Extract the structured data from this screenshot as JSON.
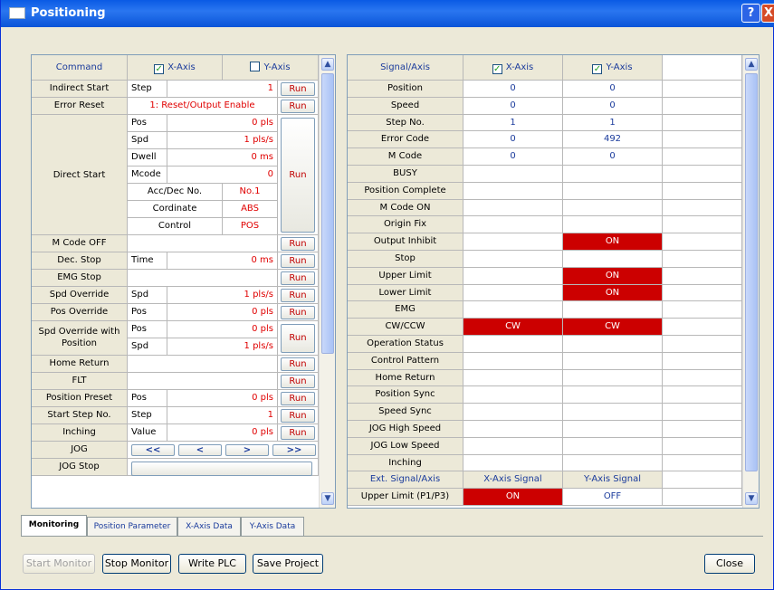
{
  "window": {
    "title": "Positioning",
    "help_icon": "?",
    "close_icon": "X"
  },
  "left": {
    "header": {
      "command": "Command",
      "x_axis": "X-Axis",
      "y_axis": "Y-Axis",
      "x_checked": true,
      "y_checked": false
    },
    "run_label": "Run",
    "rows": {
      "indirect_start": {
        "label": "Indirect Start",
        "sub": "Step",
        "value": "1"
      },
      "error_reset": {
        "label": "Error Reset",
        "value": "1: Reset/Output Enable"
      },
      "direct_start": {
        "label": "Direct Start",
        "pos": {
          "sub": "Pos",
          "value": "0 pls"
        },
        "spd": {
          "sub": "Spd",
          "value": "1 pls/s"
        },
        "dwell": {
          "sub": "Dwell",
          "value": "0 ms"
        },
        "mcode": {
          "sub": "Mcode",
          "value": "0"
        },
        "accdec": {
          "sub": "Acc/Dec No.",
          "value": "No.1"
        },
        "cordinate": {
          "sub": "Cordinate",
          "value": "ABS"
        },
        "control": {
          "sub": "Control",
          "value": "POS"
        }
      },
      "m_code_off": {
        "label": "M Code OFF"
      },
      "dec_stop": {
        "label": "Dec. Stop",
        "sub": "Time",
        "value": "0 ms"
      },
      "emg_stop": {
        "label": "EMG Stop"
      },
      "spd_override": {
        "label": "Spd Override",
        "sub": "Spd",
        "value": "1 pls/s"
      },
      "pos_override": {
        "label": "Pos Override",
        "sub": "Pos",
        "value": "0 pls"
      },
      "spd_override_pos": {
        "label1": "Spd Override with",
        "label2": "Position",
        "sub1": "Pos",
        "value1": "0 pls",
        "sub2": "Spd",
        "value2": "1 pls/s"
      },
      "home_return": {
        "label": "Home Return"
      },
      "flt": {
        "label": "FLT"
      },
      "position_preset": {
        "label": "Position Preset",
        "sub": "Pos",
        "value": "0 pls"
      },
      "start_step": {
        "label": "Start Step No.",
        "sub": "Step",
        "value": "1"
      },
      "inching": {
        "label": "Inching",
        "sub": "Value",
        "value": "0 pls"
      },
      "jog": {
        "label": "JOG",
        "btns": [
          "<<",
          "<",
          ">",
          ">>"
        ]
      },
      "jog_stop": {
        "label": "JOG Stop"
      }
    }
  },
  "right": {
    "header": {
      "signal": "Signal/Axis",
      "x_axis": "X-Axis",
      "y_axis": "Y-Axis",
      "x_checked": true,
      "y_checked": true
    },
    "rows": [
      {
        "label": "Position",
        "x": "0",
        "y": "0",
        "xon": false,
        "yon": false
      },
      {
        "label": "Speed",
        "x": "0",
        "y": "0",
        "xon": false,
        "yon": false
      },
      {
        "label": "Step No.",
        "x": "1",
        "y": "1",
        "xon": false,
        "yon": false
      },
      {
        "label": "Error Code",
        "x": "0",
        "y": "492",
        "xon": false,
        "yon": false
      },
      {
        "label": "M Code",
        "x": "0",
        "y": "0",
        "xon": false,
        "yon": false
      },
      {
        "label": "BUSY",
        "x": "",
        "y": "",
        "xon": false,
        "yon": false
      },
      {
        "label": "Position Complete",
        "x": "",
        "y": "",
        "xon": false,
        "yon": false
      },
      {
        "label": "M Code ON",
        "x": "",
        "y": "",
        "xon": false,
        "yon": false
      },
      {
        "label": "Origin Fix",
        "x": "",
        "y": "",
        "xon": false,
        "yon": false
      },
      {
        "label": "Output Inhibit",
        "x": "",
        "y": "ON",
        "xon": false,
        "yon": true
      },
      {
        "label": "Stop",
        "x": "",
        "y": "",
        "xon": false,
        "yon": false
      },
      {
        "label": "Upper Limit",
        "x": "",
        "y": "ON",
        "xon": false,
        "yon": true
      },
      {
        "label": "Lower Limit",
        "x": "",
        "y": "ON",
        "xon": false,
        "yon": true
      },
      {
        "label": "EMG",
        "x": "",
        "y": "",
        "xon": false,
        "yon": false
      },
      {
        "label": "CW/CCW",
        "x": "CW",
        "y": "CW",
        "xon": true,
        "yon": true
      },
      {
        "label": "Operation Status",
        "x": "",
        "y": "",
        "xon": false,
        "yon": false
      },
      {
        "label": "Control Pattern",
        "x": "",
        "y": "",
        "xon": false,
        "yon": false
      },
      {
        "label": "Home Return",
        "x": "",
        "y": "",
        "xon": false,
        "yon": false
      },
      {
        "label": "Position Sync",
        "x": "",
        "y": "",
        "xon": false,
        "yon": false
      },
      {
        "label": "Speed Sync",
        "x": "",
        "y": "",
        "xon": false,
        "yon": false
      },
      {
        "label": "JOG High Speed",
        "x": "",
        "y": "",
        "xon": false,
        "yon": false
      },
      {
        "label": "JOG Low Speed",
        "x": "",
        "y": "",
        "xon": false,
        "yon": false
      },
      {
        "label": "Inching",
        "x": "",
        "y": "",
        "xon": false,
        "yon": false
      }
    ],
    "ext": {
      "label": "Ext. Signal/Axis",
      "x": "X-Axis Signal",
      "y": "Y-Axis Signal"
    },
    "upper_limit_ext": {
      "label": "Upper Limit (P1/P3)",
      "x": "ON",
      "y": "OFF"
    }
  },
  "tabs": [
    "Monitoring",
    "Position Parameter",
    "X-Axis Data",
    "Y-Axis Data"
  ],
  "footer": {
    "start": "Start Monitor",
    "stop": "Stop Monitor",
    "write": "Write PLC",
    "save": "Save Project",
    "close": "Close"
  }
}
